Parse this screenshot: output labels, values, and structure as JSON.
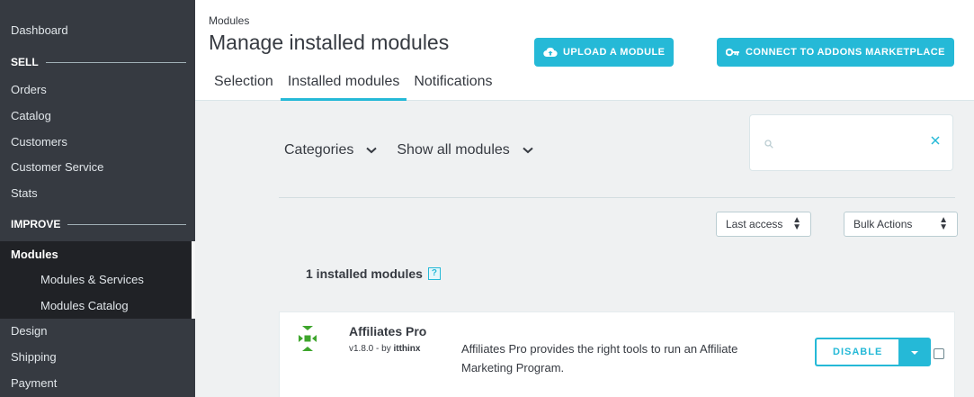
{
  "sidebar": {
    "dashboard": "Dashboard",
    "sections": [
      {
        "label": "SELL"
      },
      {
        "label": "IMPROVE"
      }
    ],
    "sell_items": [
      "Orders",
      "Catalog",
      "Customers",
      "Customer Service",
      "Stats"
    ],
    "modules": {
      "label": "Modules",
      "sub": [
        "Modules & Services",
        "Modules Catalog"
      ]
    },
    "improve_items": [
      "Design",
      "Shipping",
      "Payment"
    ]
  },
  "header": {
    "breadcrumb": "Modules",
    "title": "Manage installed modules",
    "upload_button": "UPLOAD A MODULE",
    "connect_button": "CONNECT TO ADDONS MARKETPLACE",
    "tabs": [
      {
        "label": "Selection",
        "active": false
      },
      {
        "label": "Installed modules",
        "active": true
      },
      {
        "label": "Notifications",
        "active": false
      }
    ]
  },
  "filters": {
    "categories": "Categories",
    "show": "Show all modules"
  },
  "search": {
    "placeholder": "",
    "value": ""
  },
  "sort": {
    "selected": "Last access"
  },
  "bulk": {
    "selected": "Bulk Actions"
  },
  "installed": {
    "count_label": "1 installed modules",
    "help": "?"
  },
  "module": {
    "name": "Affiliates Pro",
    "version": "v1.8.0",
    "by_label": "by",
    "author": "itthinx",
    "description": "Affiliates Pro provides the right tools to run an Affiliate Marketing Program.",
    "action": "DISABLE",
    "logo_color": "#3ea52c"
  },
  "colors": {
    "accent": "#25b9d7",
    "sidebar": "#363a41"
  }
}
